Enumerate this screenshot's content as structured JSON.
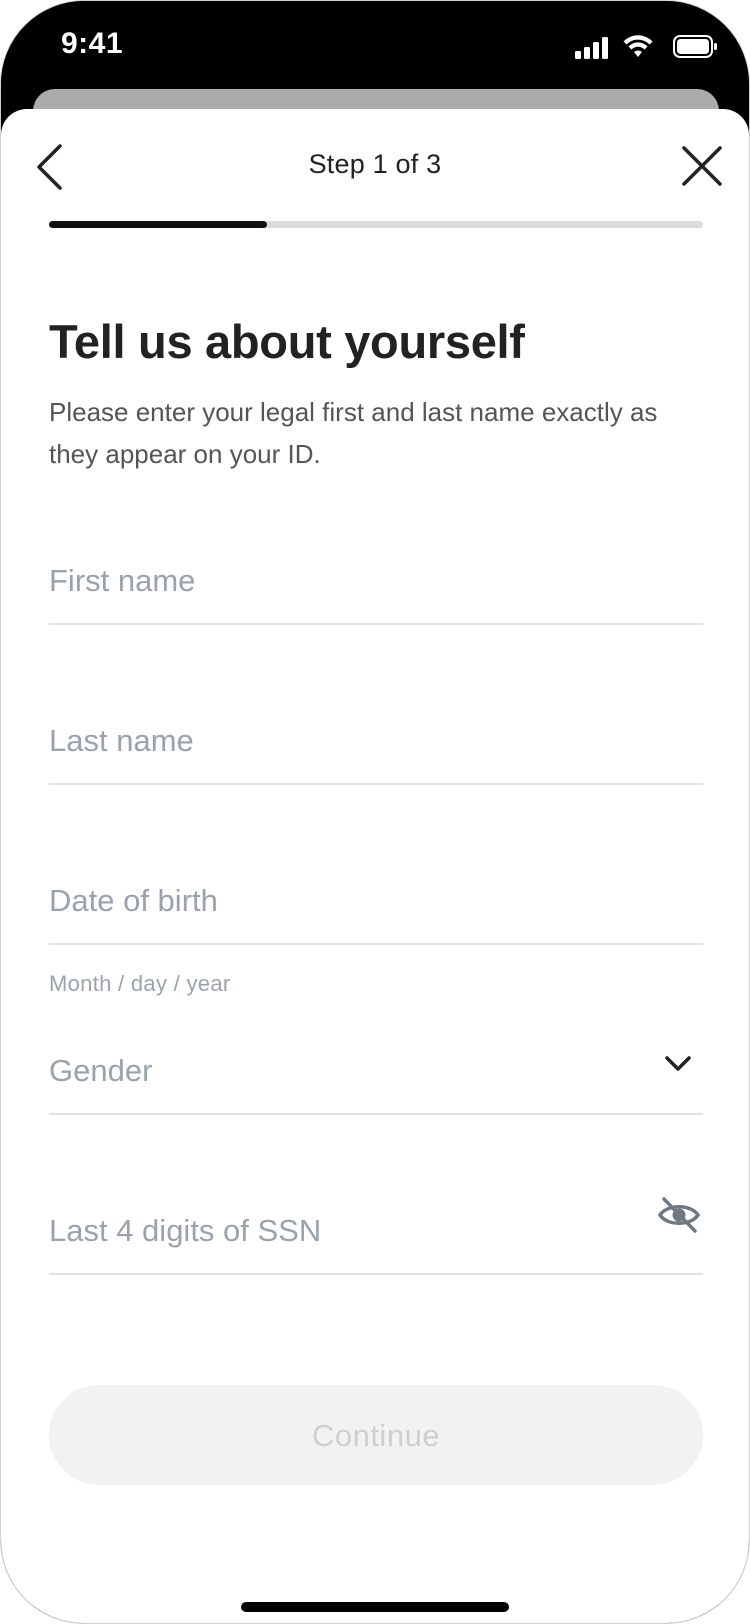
{
  "status_bar": {
    "time": "9:41",
    "icons": [
      "signal-icon",
      "wifi-icon",
      "battery-icon"
    ]
  },
  "header": {
    "back_icon": "chevron-left-icon",
    "step_label": "Step 1 of 3",
    "close_icon": "close-icon",
    "progress_fraction": 0.333
  },
  "content": {
    "title": "Tell us about yourself",
    "subtitle": "Please enter your legal first and last name exactly as they appear on your ID."
  },
  "form": {
    "first_name": {
      "placeholder": "First name"
    },
    "last_name": {
      "placeholder": "Last name"
    },
    "date_of_birth": {
      "placeholder": "Date of birth",
      "helper": "Month / day / year"
    },
    "gender": {
      "placeholder": "Gender",
      "icon": "chevron-down-icon"
    },
    "ssn": {
      "placeholder": "Last 4 digits of SSN",
      "icon": "eye-slash-icon"
    }
  },
  "footer": {
    "continue_label": "Continue"
  },
  "colors": {
    "placeholder": "#9aa3ad",
    "progress_fill": "#111111",
    "progress_track": "#dcdcdc",
    "button_disabled_bg": "#f2f2f2",
    "button_disabled_text": "#cfcfcf"
  }
}
